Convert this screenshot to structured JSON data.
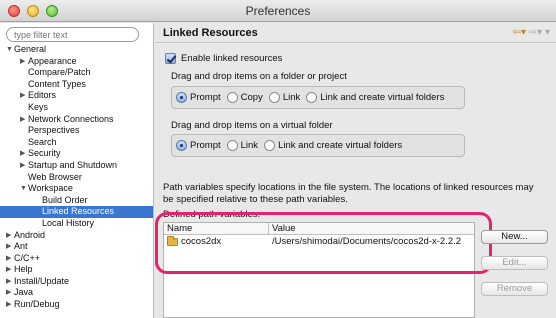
{
  "window": {
    "title": "Preferences"
  },
  "sidebar": {
    "filter_placeholder": "type filter text",
    "tree": [
      {
        "label": "General",
        "level": 0,
        "expanded": true
      },
      {
        "label": "Appearance",
        "level": 1,
        "arrow": true
      },
      {
        "label": "Compare/Patch",
        "level": 1
      },
      {
        "label": "Content Types",
        "level": 1
      },
      {
        "label": "Editors",
        "level": 1,
        "arrow": true
      },
      {
        "label": "Keys",
        "level": 1
      },
      {
        "label": "Network Connections",
        "level": 1,
        "arrow": true
      },
      {
        "label": "Perspectives",
        "level": 1
      },
      {
        "label": "Search",
        "level": 1
      },
      {
        "label": "Security",
        "level": 1,
        "arrow": true
      },
      {
        "label": "Startup and Shutdown",
        "level": 1,
        "arrow": true
      },
      {
        "label": "Web Browser",
        "level": 1
      },
      {
        "label": "Workspace",
        "level": 1,
        "expanded": true
      },
      {
        "label": "Build Order",
        "level": 2
      },
      {
        "label": "Linked Resources",
        "level": 2,
        "selected": true
      },
      {
        "label": "Local History",
        "level": 2
      },
      {
        "label": "Android",
        "level": 0,
        "arrow": true
      },
      {
        "label": "Ant",
        "level": 0,
        "arrow": true
      },
      {
        "label": "C/C++",
        "level": 0,
        "arrow": true
      },
      {
        "label": "Help",
        "level": 0,
        "arrow": true
      },
      {
        "label": "Install/Update",
        "level": 0,
        "arrow": true
      },
      {
        "label": "Java",
        "level": 0,
        "arrow": true
      },
      {
        "label": "Run/Debug",
        "level": 0,
        "arrow": true
      }
    ]
  },
  "main": {
    "title": "Linked Resources",
    "enable_checkbox": {
      "label": "Enable linked resources",
      "checked": true
    },
    "group1": {
      "label": "Drag and drop items on a folder or project",
      "options": [
        {
          "label": "Prompt",
          "selected": true
        },
        {
          "label": "Copy",
          "selected": false
        },
        {
          "label": "Link",
          "selected": false
        },
        {
          "label": "Link and create virtual folders",
          "selected": false
        }
      ]
    },
    "group2": {
      "label": "Drag and drop items on a virtual folder",
      "options": [
        {
          "label": "Prompt",
          "selected": true
        },
        {
          "label": "Link",
          "selected": false
        },
        {
          "label": "Link and create virtual folders",
          "selected": false
        }
      ]
    },
    "description": "Path variables specify locations in the file system. The locations of linked resources may be specified relative to these path variables.",
    "defined_label": "Defined path variables:",
    "table": {
      "headers": {
        "name": "Name",
        "value": "Value"
      },
      "rows": [
        {
          "name": "cocos2dx",
          "value": "/Users/shimodai/Documents/cocos2d-x-2.2.2"
        }
      ]
    },
    "buttons": {
      "new": "New...",
      "edit": "Edit...",
      "remove": "Remove"
    },
    "highlight_color": "#e3236c",
    "selection_color": "#3a75d0"
  }
}
